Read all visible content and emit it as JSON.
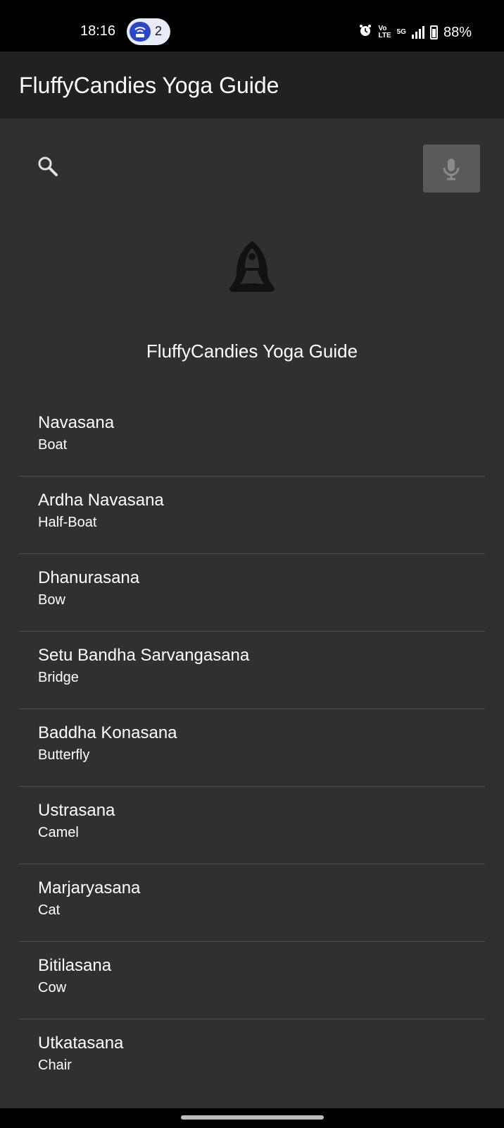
{
  "status_bar": {
    "time": "18:16",
    "notification_count": "2",
    "network_label_top": "Vo",
    "network_label_bottom": "LTE",
    "network_type": "5G",
    "battery": "88%",
    "icons": [
      "wifi-hotspot-icon",
      "alarm-icon",
      "signal-icon",
      "battery-icon"
    ]
  },
  "app_bar": {
    "title": "FluffyCandies Yoga Guide"
  },
  "search": {
    "icon": "search-icon",
    "mic_icon": "mic-icon"
  },
  "header": {
    "logo_icon": "meditation-logo-icon",
    "subtitle": "FluffyCandies Yoga Guide"
  },
  "poses": [
    {
      "name": "Navasana",
      "common": "Boat"
    },
    {
      "name": "Ardha Navasana",
      "common": "Half-Boat"
    },
    {
      "name": "Dhanurasana",
      "common": "Bow"
    },
    {
      "name": "Setu Bandha Sarvangasana",
      "common": "Bridge"
    },
    {
      "name": "Baddha Konasana",
      "common": "Butterfly"
    },
    {
      "name": "Ustrasana",
      "common": "Camel"
    },
    {
      "name": "Marjaryasana",
      "common": "Cat"
    },
    {
      "name": "Bitilasana",
      "common": "Cow"
    },
    {
      "name": "Utkatasana",
      "common": "Chair"
    }
  ],
  "colors": {
    "background": "#303030",
    "app_bar": "#212121",
    "mic_button": "#5a5a5a",
    "divider": "#4e4e4e",
    "status_pill": "#2b46c9"
  }
}
